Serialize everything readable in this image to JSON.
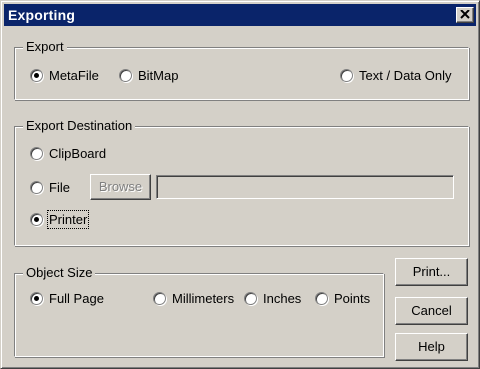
{
  "window": {
    "title": "Exporting",
    "close_icon": "close-x-icon"
  },
  "export_group": {
    "caption": "Export",
    "options": [
      {
        "label": "MetaFile",
        "checked": true
      },
      {
        "label": "BitMap",
        "checked": false
      },
      {
        "label": "Text / Data Only",
        "checked": false
      }
    ]
  },
  "destination_group": {
    "caption": "Export Destination",
    "clipboard_label": "ClipBoard",
    "file_label": "File",
    "browse_label": "Browse",
    "file_path_value": "",
    "printer_label": "Printer",
    "selected": "Printer"
  },
  "size_group": {
    "caption": "Object Size",
    "options": [
      {
        "label": "Full Page",
        "checked": true
      },
      {
        "label": "Millimeters",
        "checked": false
      },
      {
        "label": "Inches",
        "checked": false
      },
      {
        "label": "Points",
        "checked": false
      }
    ]
  },
  "buttons": {
    "print": "Print...",
    "cancel": "Cancel",
    "help": "Help"
  },
  "colors": {
    "face": "#d4d0c8",
    "titlebar": "#0a246a"
  }
}
